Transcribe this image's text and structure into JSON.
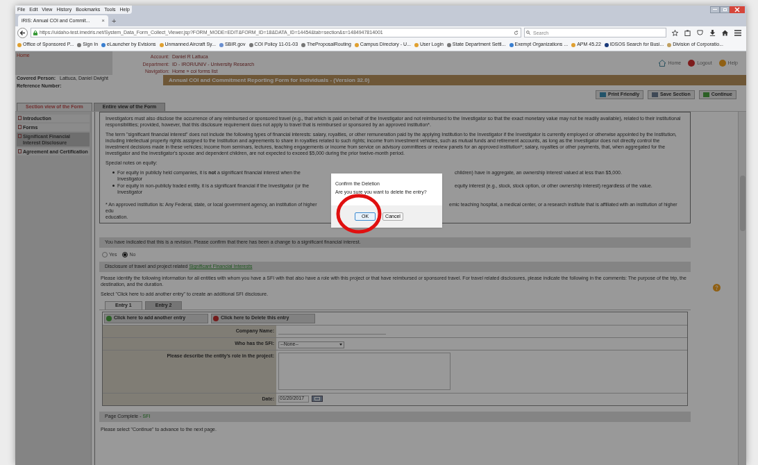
{
  "menu": [
    "File",
    "Edit",
    "View",
    "History",
    "Bookmarks",
    "Tools",
    "Help"
  ],
  "browser_tab": {
    "title": "iRIS: Annual COI and Commit...",
    "close": "×",
    "new_tab": "+"
  },
  "address_bar": {
    "url": "https://uidaho-test.imedris.net/System_Data_Form_Collect_Viewer.jsp?FORM_MODE=EDIT&FORM_ID=18&DATA_ID=14454&tab=section&s=1484947814001",
    "search_placeholder": "Search"
  },
  "bookmarks": [
    "Office of Sponsored P...",
    "Sign In",
    "eLauncher by Evisions",
    "Unmanned Aircraft Sy...",
    "SBIR.gov",
    "COI Policy 11-01-03",
    "TheProposalRouting",
    "Campus Directory - U...",
    "User Login",
    "State Department Settl...",
    "Exempt Organizations ...",
    "APM 45.22",
    "IDSOS Search for Busi...",
    "Division of Corporatio..."
  ],
  "header": {
    "home_link": "Home",
    "info": [
      {
        "label": "Account:",
        "value": "Daniel R Lattuca"
      },
      {
        "label": "Department:",
        "value": "ID - IROR/UNIV - University Research"
      },
      {
        "label": "Navigation:",
        "value": "Home » coi forms list"
      }
    ],
    "actions": [
      {
        "label": "Home",
        "kind": "home"
      },
      {
        "label": "Logout",
        "kind": "logout"
      },
      {
        "label": "Help",
        "kind": "help"
      }
    ],
    "covered_person": {
      "label": "Covered Person:",
      "value": "Lattuca, Daniel Dwight"
    },
    "reference_number": {
      "label": "Reference Number:"
    }
  },
  "form_title": "Annual COI and Commitment Reporting Form for Individuals - (Version 32.0)",
  "toolbar_buttons": [
    {
      "label": "Print Friendly",
      "kind": "print"
    },
    {
      "label": "Save Section",
      "kind": "save"
    },
    {
      "label": "Continue",
      "kind": "continue"
    }
  ],
  "view_tabs": [
    {
      "label": "Section view of the Form",
      "selected": true
    },
    {
      "label": "Entire view of the Form",
      "selected": false
    }
  ],
  "sidebar": {
    "items": [
      {
        "label": "Introduction",
        "selected": false
      },
      {
        "label": "Forms",
        "selected": false
      },
      {
        "label": "Significant Financial Interest Disclosure",
        "selected": true
      },
      {
        "label": "Agreement and Certification",
        "selected": false
      }
    ]
  },
  "info_box": {
    "paragraphs": [
      "Investigators must also disclose the occurrence of any reimbursed or sponsored travel (e.g., that which is paid on behalf of the Investigator and not reimbursed to the Investigator so that the exact monetary value may not be readily available), related to their institutional responsibilities; provided, however, that this disclosure requirement does not apply to travel that is reimbursed or sponsored by an approved institution*.",
      "The term \"significant financial interest\" does not include the following types of financial interests: salary, royalties, or other remuneration paid by the applying Institution to the Investigator if the Investigator is currently employed or otherwise appointed by the Institution, including intellectual property rights assigned to the Institution and agreements to share in royalties related to such rights; income from investment vehicles, such as mutual funds and retirement accounts, as long as the Investigator does not directly control the investment decisions made in these vehicles; income from seminars, lectures, teaching engagements or income from service on advisory committees or review panels for an approved institution*; salary, royalties or other payments, that, when aggregated for the investigator and the investigator's spouse and dependent children, are not expected to exceed $5,000 during the prior twelve-month period."
    ],
    "equity_heading": "Special notes on equity:",
    "bullets": [
      {
        "left": "For equity in publicly held companies, it is **not** a significant financial interest when the Investigator",
        "right": "children) have in aggregate, an ownership interest valued at less than $5,000."
      },
      {
        "left": "For equity in non-publicly traded entity, it is a significant financial if the Investigator (or the Investigator",
        "right": "equity interest (e.g., stock, stock option, or other ownership interest) regardless of the value."
      }
    ],
    "footnote": {
      "left": "* An approved institution is: Any Federal, state, or local government agency, an institution of higher edu",
      "right": "emic teaching hospital, a medical center, or a research institute that is affiliated with an institution of higher",
      "continuation": "education."
    }
  },
  "dialog": {
    "title": "Confirm the Deletion",
    "message": "Are you sure you want to delete the entry?",
    "buttons": [
      "OK",
      "Cancel"
    ]
  },
  "revision": {
    "prompt": "You have indicated that this is a revision. Please confirm that there has been a change to a significant financial interest.",
    "options": [
      {
        "label": "Yes",
        "selected": false
      },
      {
        "label": "No",
        "selected": true
      }
    ]
  },
  "disclosure": {
    "heading": "Disclosure of travel and project related ",
    "heading_link": "Significant Financial Interests",
    "instructions": "Please identify the following information for all entities with whom you have a SFI with that also have a role with this project or that have reimbursed or sponsored travel. For travel related disclosures, please indicate the following in the comments: The purpose of the trip, the destination, and the duration.",
    "hint": "Select \"Click here to add another entry\" to create an additional SFI disclosure.",
    "entry_tabs": [
      {
        "label": "Entry 1",
        "selected": true
      },
      {
        "label": "Entry 2",
        "selected": false
      }
    ],
    "actions": [
      {
        "label": "Click here to add another entry",
        "kind": "add"
      },
      {
        "label": "Click here to Delete this entry",
        "kind": "delete"
      }
    ],
    "fields": [
      {
        "label": "Company Name:",
        "kind": "text"
      },
      {
        "label": "Who has the SFI:",
        "kind": "select",
        "value": "--None--"
      },
      {
        "label": "Please describe the entity's role in the project:",
        "kind": "textarea"
      },
      {
        "label": "Date:",
        "kind": "date",
        "value": "01/20/2017"
      }
    ]
  },
  "page_complete": {
    "label": "Page Complete - ",
    "link": "SFI",
    "note": "Please select \"Continue\" to advance to the next page."
  }
}
